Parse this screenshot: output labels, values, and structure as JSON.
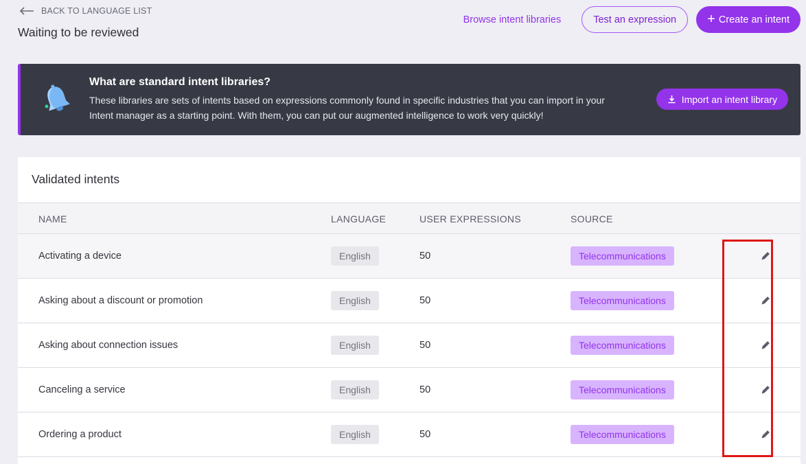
{
  "header": {
    "back_label": "BACK TO LANGUAGE LIST",
    "title": "Waiting to be reviewed",
    "browse_label": "Browse intent libraries",
    "test_label": "Test an expression",
    "create_label": "Create an intent"
  },
  "banner": {
    "icon": "bell-icon",
    "title": "What are standard intent libraries?",
    "description": "These libraries are sets of intents based on expressions commonly found in specific industries that you can import in your Intent manager as a starting point. With them, you can put our augmented intelligence to work very quickly!",
    "import_label": "Import an intent library"
  },
  "table": {
    "title": "Validated intents",
    "columns": {
      "name": "NAME",
      "language": "LANGUAGE",
      "expressions": "USER EXPRESSIONS",
      "source": "SOURCE"
    },
    "rows": [
      {
        "name": "Activating a device",
        "language": "English",
        "expressions": "50",
        "source": "Telecommunications"
      },
      {
        "name": "Asking about a discount or promotion",
        "language": "English",
        "expressions": "50",
        "source": "Telecommunications"
      },
      {
        "name": "Asking about connection issues",
        "language": "English",
        "expressions": "50",
        "source": "Telecommunications"
      },
      {
        "name": "Canceling a service",
        "language": "English",
        "expressions": "50",
        "source": "Telecommunications"
      },
      {
        "name": "Ordering a product",
        "language": "English",
        "expressions": "50",
        "source": "Telecommunications"
      }
    ]
  },
  "colors": {
    "accent": "#9333ea",
    "banner_bg": "#373a44",
    "highlight": "#e01515"
  }
}
